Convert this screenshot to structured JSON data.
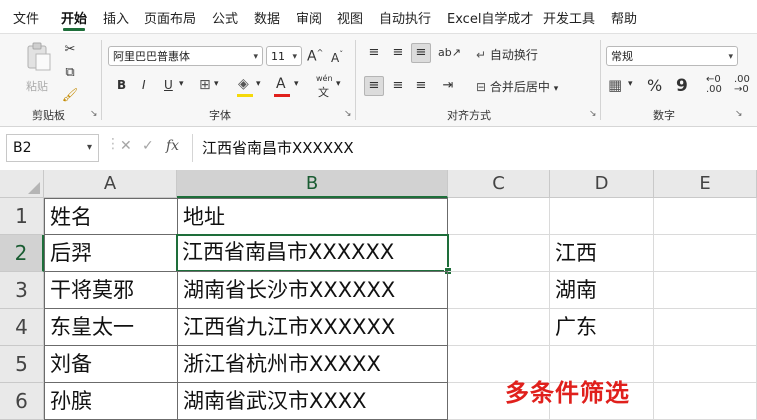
{
  "menu": {
    "tabs": [
      "文件",
      "开始",
      "插入",
      "页面布局",
      "公式",
      "数据",
      "审阅",
      "视图",
      "自动执行",
      "Excel自学成才",
      "开发工具",
      "帮助"
    ],
    "active": "开始"
  },
  "ribbon": {
    "clipboard": {
      "paste_label": "粘贴",
      "group_label": "剪贴板"
    },
    "font": {
      "font_name": "阿里巴巴普惠体",
      "font_size": "11",
      "grow": "A",
      "shrink": "A",
      "bold": "B",
      "italic": "I",
      "underline": "U",
      "phonetic": "wén",
      "group_label": "字体"
    },
    "alignment": {
      "wrap_text": "自动换行",
      "merge_center": "合并后居中",
      "group_label": "对齐方式"
    },
    "number": {
      "format": "常规",
      "percent": "%",
      "comma": "9",
      "group_label": "数字"
    }
  },
  "formula_bar": {
    "name_box": "B2",
    "fx": "fx",
    "content": "江西省南昌市XXXXXX"
  },
  "sheet": {
    "columns": [
      "A",
      "B",
      "C",
      "D",
      "E"
    ],
    "selected_column": "B",
    "selected_row": "2",
    "rows": [
      {
        "num": "1",
        "A": "姓名",
        "B": "地址",
        "C": "",
        "D": ""
      },
      {
        "num": "2",
        "A": "后羿",
        "B": "江西省南昌市XXXXXX",
        "C": "",
        "D": "江西"
      },
      {
        "num": "3",
        "A": "干将莫邪",
        "B": "湖南省长沙市XXXXXX",
        "C": "",
        "D": "湖南"
      },
      {
        "num": "4",
        "A": "东皇太一",
        "B": "江西省九江市XXXXXX",
        "C": "",
        "D": "广东"
      },
      {
        "num": "5",
        "A": "刘备",
        "B": "浙江省杭州市XXXXX",
        "C": "",
        "D": ""
      },
      {
        "num": "6",
        "A": "孙膑",
        "B": "湖南省武汉市XXXX",
        "C": "",
        "D": ""
      }
    ]
  },
  "overlay": {
    "caption": "多条件筛选"
  }
}
